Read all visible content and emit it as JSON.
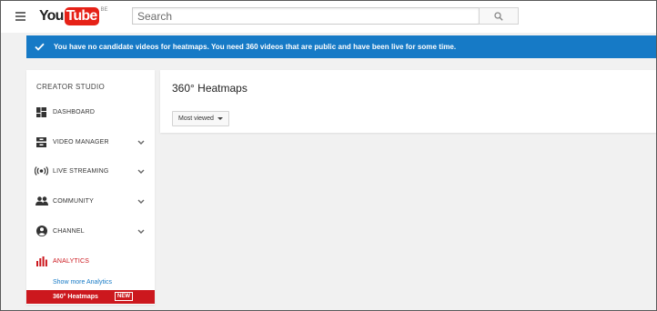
{
  "header": {
    "logo_you": "You",
    "logo_tube": "Tube",
    "logo_region": "BE",
    "search_placeholder": "Search"
  },
  "banner": {
    "message": "You have no candidate videos for heatmaps. You need 360 videos that are public and have been live for some time."
  },
  "sidebar": {
    "title": "CREATOR STUDIO",
    "items": [
      {
        "label": "DASHBOARD",
        "icon": "dashboard-icon",
        "expandable": false
      },
      {
        "label": "VIDEO MANAGER",
        "icon": "video-manager-icon",
        "expandable": true
      },
      {
        "label": "LIVE STREAMING",
        "icon": "live-streaming-icon",
        "expandable": true
      },
      {
        "label": "COMMUNITY",
        "icon": "community-icon",
        "expandable": true
      },
      {
        "label": "CHANNEL",
        "icon": "channel-icon",
        "expandable": true
      },
      {
        "label": "ANALYTICS",
        "icon": "analytics-icon",
        "expandable": false,
        "active": true
      }
    ],
    "show_more": "Show more Analytics",
    "active_sub_item": {
      "label": "360° Heatmaps",
      "badge": "NEW"
    }
  },
  "main": {
    "title": "360° Heatmaps",
    "sort_selected": "Most viewed"
  },
  "colors": {
    "brand_red": "#cc181e",
    "banner_blue": "#167ac6",
    "link_blue": "#167ac6"
  }
}
